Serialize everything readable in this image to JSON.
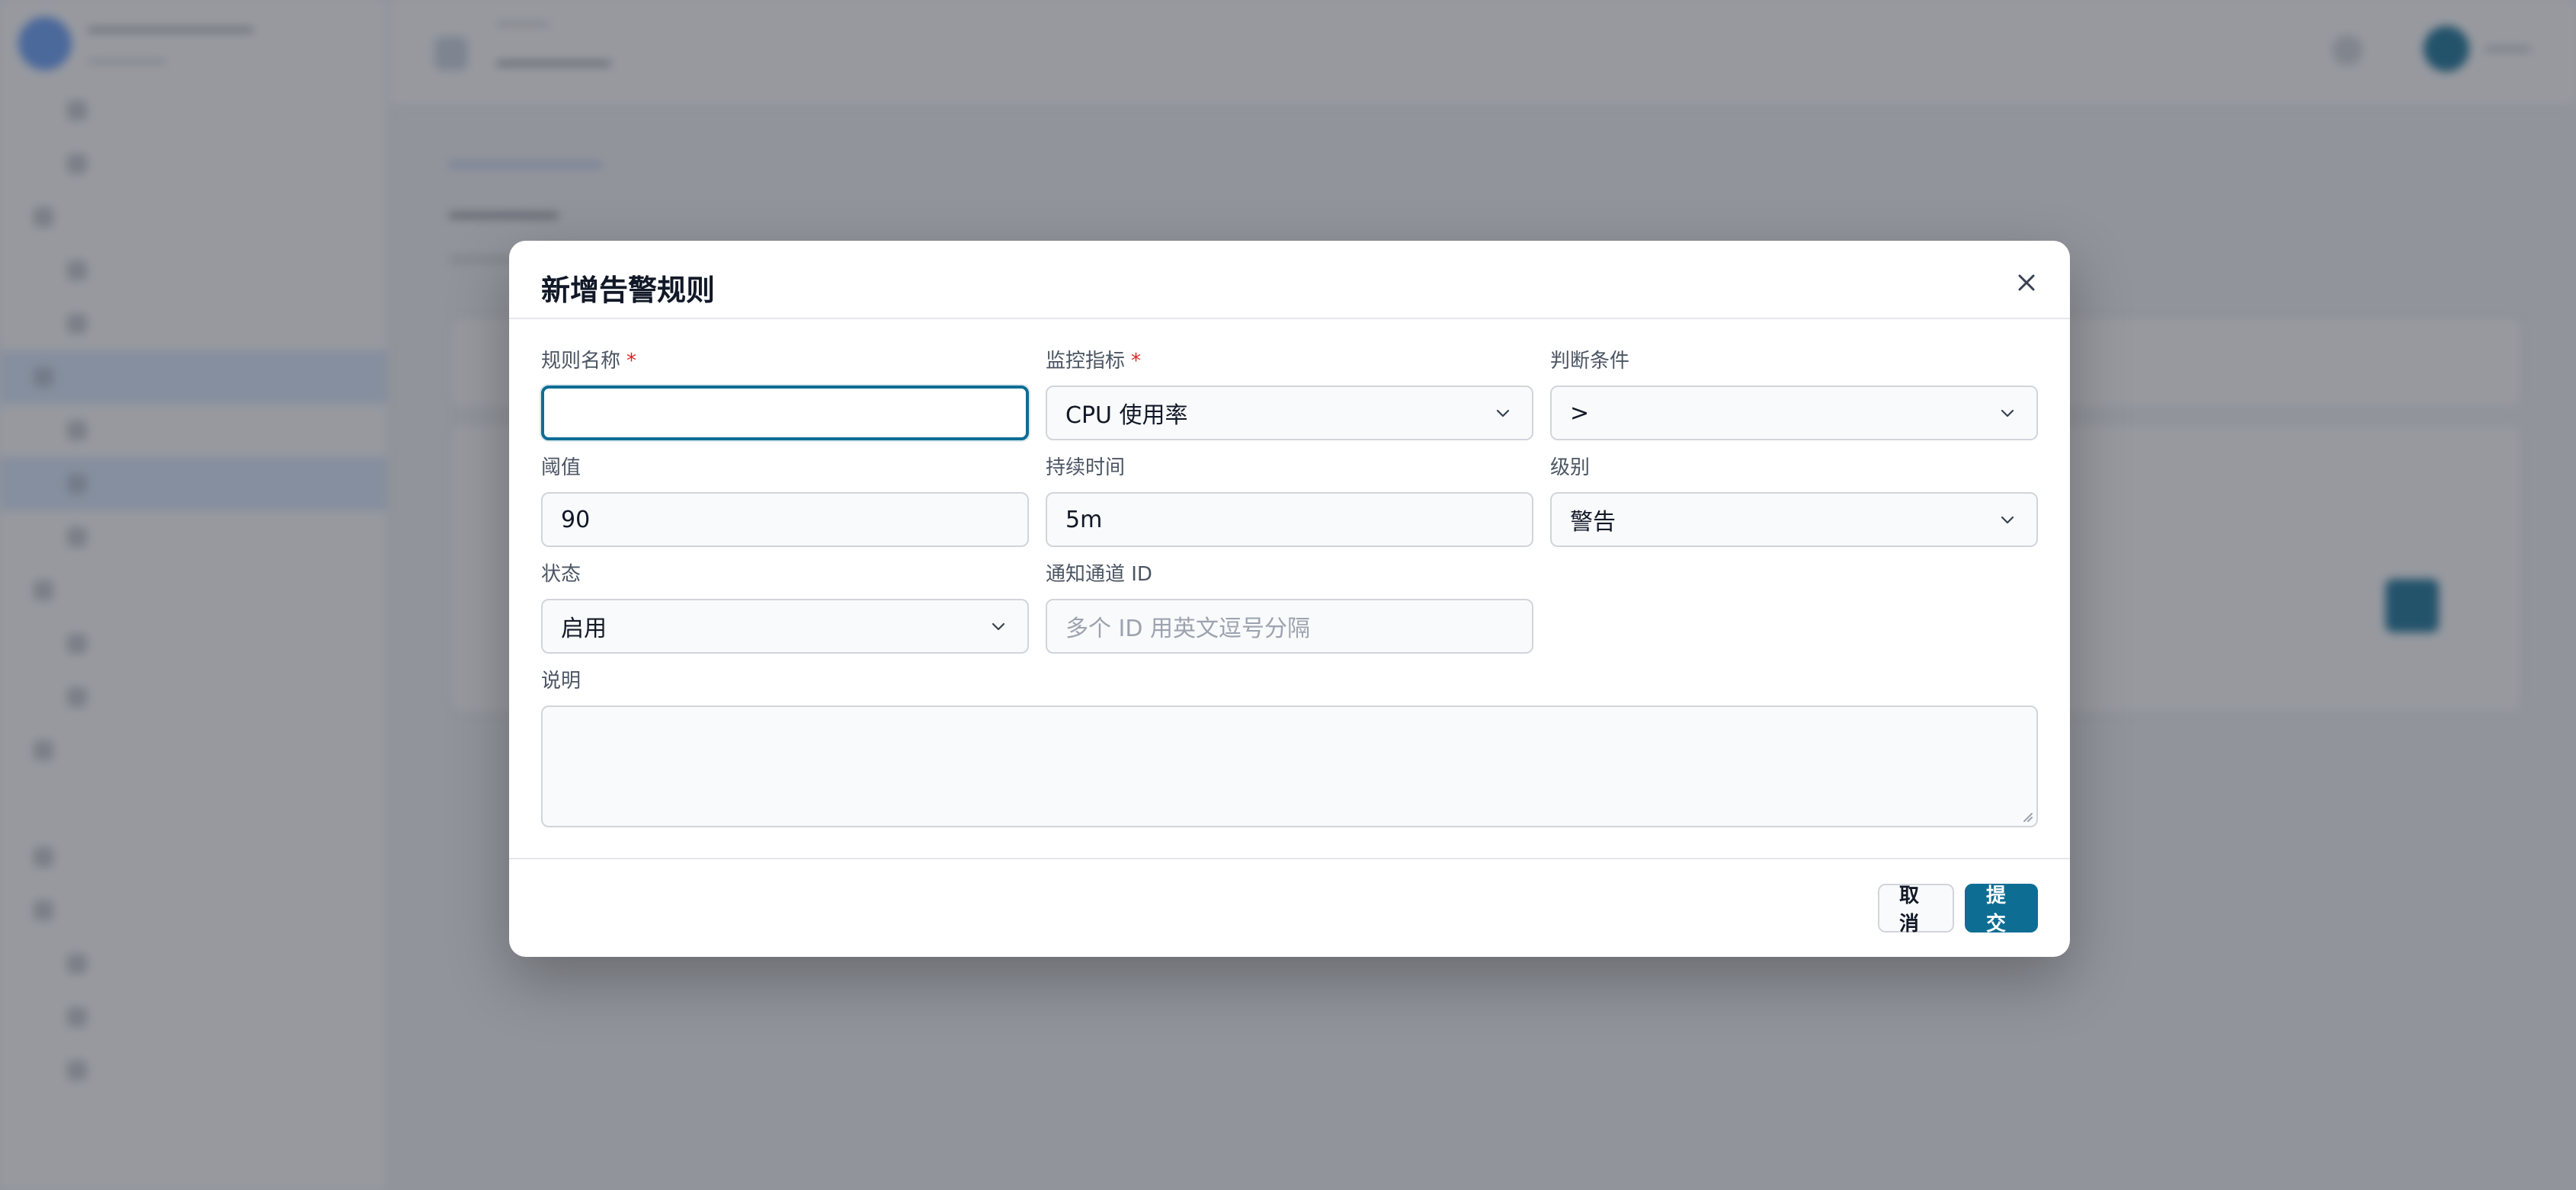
{
  "modal": {
    "title": "新增告警规则",
    "fields": {
      "rule_name": {
        "label": "规则名称",
        "required_mark": "*",
        "value": ""
      },
      "metric": {
        "label": "监控指标",
        "required_mark": "*",
        "value": "CPU 使用率"
      },
      "condition": {
        "label": "判断条件",
        "value": ">"
      },
      "threshold": {
        "label": "阈值",
        "value": "90"
      },
      "duration": {
        "label": "持续时间",
        "value": "5m"
      },
      "level": {
        "label": "级别",
        "value": "警告"
      },
      "status": {
        "label": "状态",
        "value": "启用"
      },
      "channel_ids": {
        "label": "通知通道 ID",
        "value": "",
        "placeholder": "多个 ID 用英文逗号分隔"
      },
      "description": {
        "label": "说明",
        "value": ""
      }
    },
    "buttons": {
      "cancel": "取消",
      "submit": "提交"
    }
  },
  "colors": {
    "primary": "#0e6d93",
    "required": "#dc2626",
    "overlay": "rgba(55,60,70,0.52)"
  },
  "icons": {
    "close": "close-icon",
    "dropdown": "chevron-down-icon"
  }
}
